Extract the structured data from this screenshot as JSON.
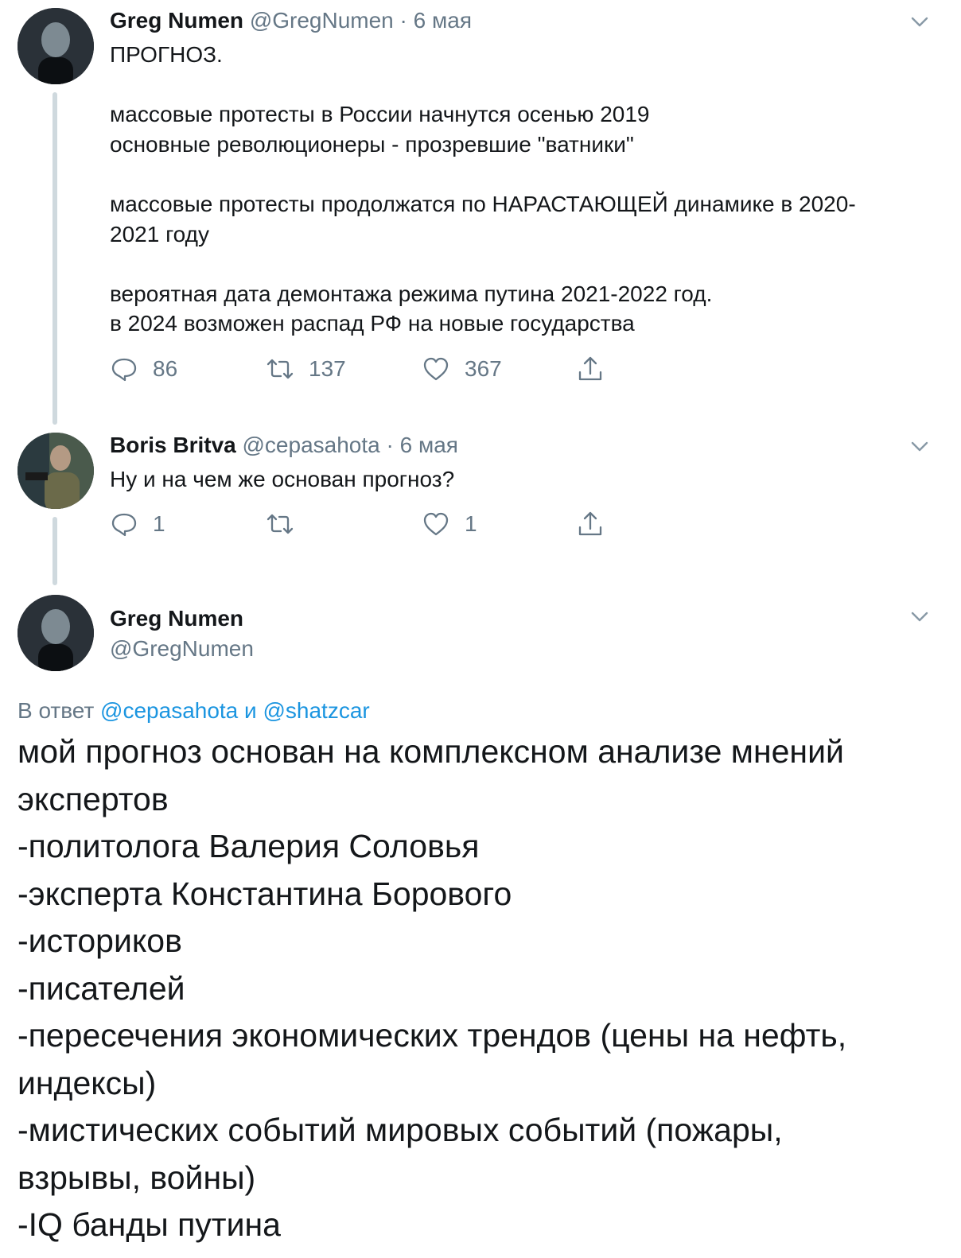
{
  "tweet1": {
    "name": "Greg Numen",
    "handle": "@GregNumen",
    "sep": "·",
    "date": "6 мая",
    "lines": [
      "ПРОГНОЗ.",
      "",
      "массовые протесты в России начнутся осенью 2019",
      "основные революционеры - прозревшие \"ватники\"",
      "",
      "массовые протесты продолжатся по НАРАСТАЮЩЕЙ динамике в 2020-",
      "2021 году",
      "",
      "вероятная дата демонтажа режима путина 2021-2022 год.",
      "в 2024 возможен распад РФ на новые государства"
    ],
    "replies": "86",
    "retweets": "137",
    "likes": "367"
  },
  "tweet2": {
    "name": "Boris Britva",
    "handle": "@cepasahota",
    "sep": "·",
    "date": "6 мая",
    "text": "Ну и на чем же основан прогноз?",
    "replies": "1",
    "retweets": "",
    "likes": "1"
  },
  "tweet3": {
    "name": "Greg Numen",
    "handle": "@GregNumen",
    "reply_prefix": "В ответ",
    "reply_mention1": "@cepasahota",
    "reply_and": "и",
    "reply_mention2": "@shatzcar",
    "lines": [
      "мой прогноз основан на комплексном анализе мнений",
      "экспертов",
      "-политолога Валерия Соловья",
      "-эксперта Константина Борового",
      "-историков",
      "-писателей",
      "-пересечения экономических трендов (цены на нефть,",
      "индексы)",
      "-мистических событий мировых событий (пожары,",
      "взрывы, войны)",
      "-IQ банды путина"
    ]
  },
  "icons": {
    "reply": "reply-icon",
    "retweet": "retweet-icon",
    "like": "heart-icon",
    "share": "share-icon",
    "more": "chevron-down-icon"
  },
  "colors": {
    "text": "#14171a",
    "secondary": "#657786",
    "link": "#1b95e0",
    "thread_line": "#cfd9de"
  }
}
